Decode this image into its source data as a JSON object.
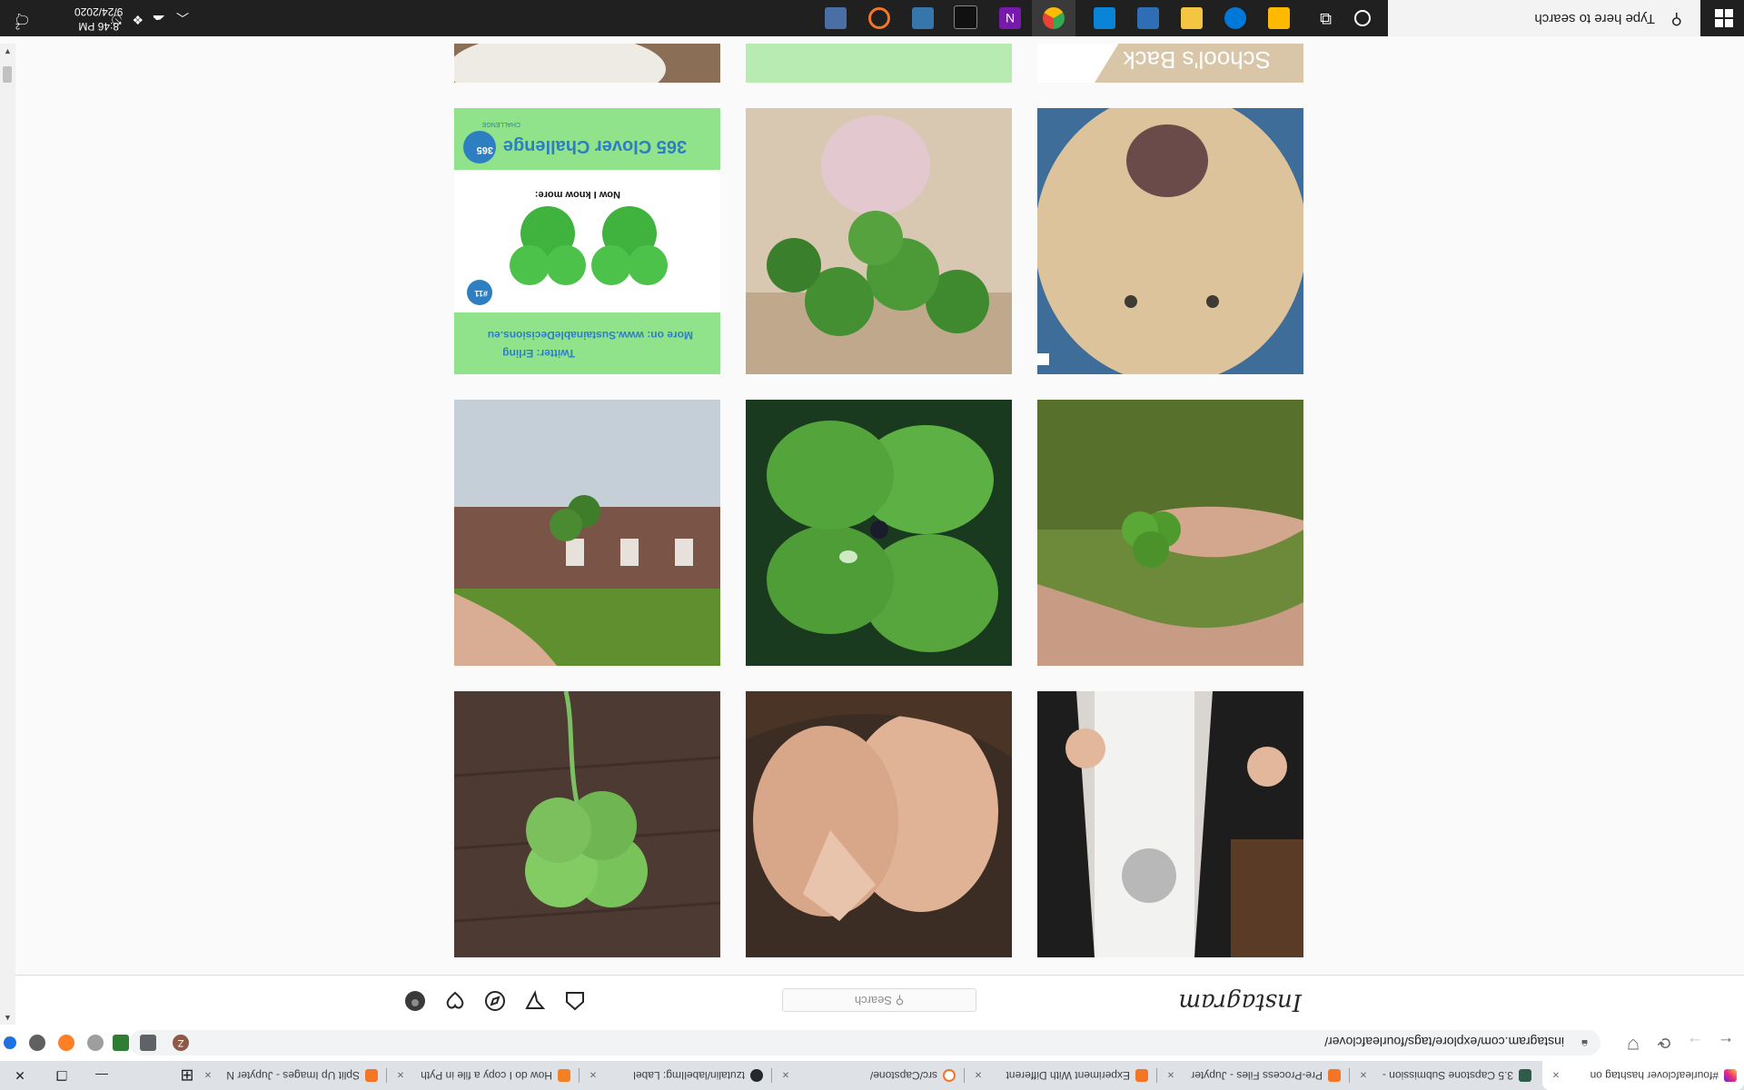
{
  "browser": {
    "tabs": [
      {
        "label": "Split Up Images - Jupyter N",
        "close": "×"
      },
      {
        "label": "How do I copy a file in Pyth",
        "close": "×"
      },
      {
        "label": "tzutalin/labelImg: Label",
        "close": "×"
      },
      {
        "label": "src/Capstone/",
        "close": "×"
      },
      {
        "label": "Experiment With Different",
        "close": "×"
      },
      {
        "label": "Pre-Process Files - Jupyter",
        "close": "×"
      },
      {
        "label": "3.5 Capstone Submission - ",
        "close": "×"
      },
      {
        "label": "#fourleafclover hashtag on",
        "close": "×"
      }
    ],
    "url": "instagram.com/explore/tags/fourleafclover/"
  },
  "instagram": {
    "logo": "Instagram",
    "search_placeholder": "Search",
    "nav_icons": [
      "home-icon",
      "direct-icon",
      "explore-icon",
      "activity-heart-icon",
      "profile-avatar"
    ],
    "tiles": [
      {
        "name": "tile-woman-jacket"
      },
      {
        "name": "tile-couple-selfie"
      },
      {
        "name": "tile-clover-on-wood"
      },
      {
        "name": "tile-hand-clover"
      },
      {
        "name": "tile-clover-leaves"
      },
      {
        "name": "tile-clover-house"
      },
      {
        "name": "tile-dog"
      },
      {
        "name": "tile-clover-plant-vase"
      },
      {
        "name": "tile-365-clover-challenge",
        "challenge_title": "365 Clover Challenge",
        "challenge_badge": "365",
        "challenge_sub": "CHALLENGE",
        "now_i_know": "Now I know more:",
        "number_badge": "#11",
        "more_on": "More on: www.SustainableDecisions.eu",
        "twitter": "Twitter: Erling"
      },
      {
        "name": "tile-school-back",
        "text": "School's Back"
      },
      {
        "name": "tile-green-block"
      },
      {
        "name": "tile-top-left"
      }
    ]
  },
  "taskbar": {
    "search_placeholder": "Type here to search",
    "time": "8:46 PM",
    "date": "9/24/2020",
    "notification_count": "2"
  },
  "colors": {
    "accent": "#0095f6",
    "taskbar": "#202020",
    "tabstrip": "#dee1e6"
  }
}
